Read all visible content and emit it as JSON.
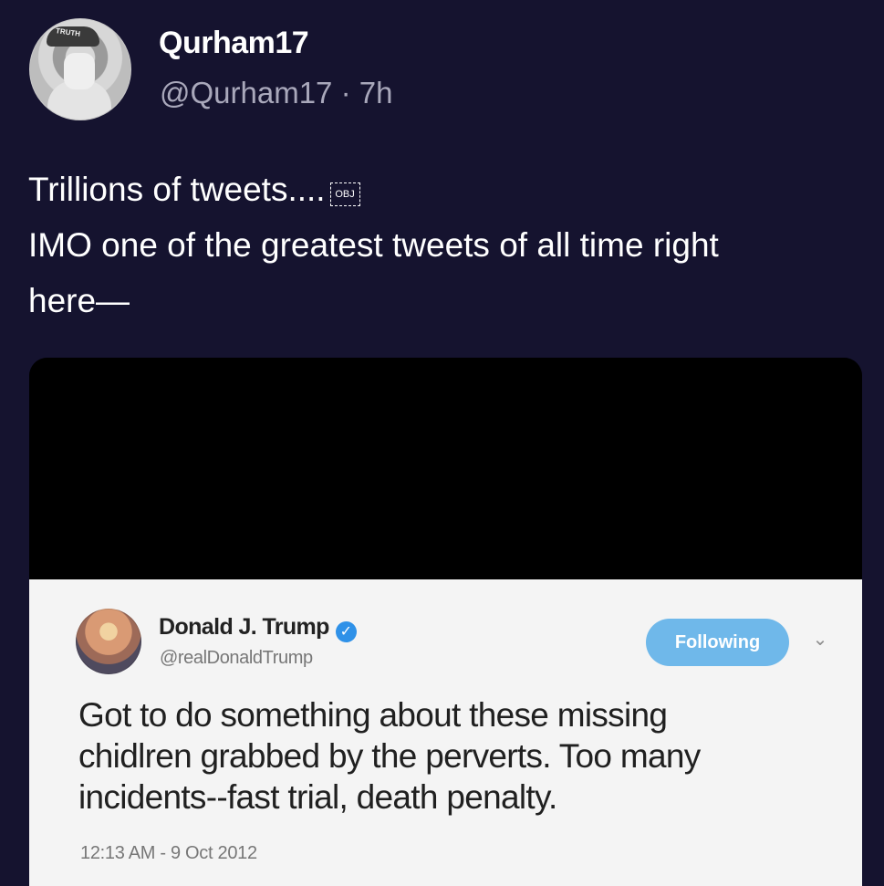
{
  "post": {
    "author": {
      "display_name": "Qurham17",
      "handle_time": "@Qurham17 · 7h",
      "avatar_icon": "profile-photo-icon",
      "avatar_cap_text": "TRUTH"
    },
    "text_lines": [
      "Trillions of tweets....",
      "IMO one of the greatest tweets of all time right",
      "here—"
    ],
    "inline_object_label": "OBJ"
  },
  "media": {
    "embedded_tweet": {
      "display_name": "Donald J. Trump",
      "handle": "@realDonaldTrump",
      "verified_icon": "verified-badge-icon",
      "following_label": "Following",
      "chevron_icon": "chevron-down-icon",
      "body_lines": [
        "Got to do something about these missing",
        "chidlren grabbed by the perverts. Too many",
        "incidents--fast trial, death penalty."
      ],
      "timestamp": "12:13 AM - 9 Oct 2012"
    }
  },
  "colors": {
    "background": "#15132f",
    "primary_text": "#ffffff",
    "secondary_text": "#a9a8bb",
    "embedded_background": "#f4f4f4",
    "embedded_text": "#202020",
    "follow_button": "#6fb8ea",
    "verified": "#2f91e8"
  }
}
